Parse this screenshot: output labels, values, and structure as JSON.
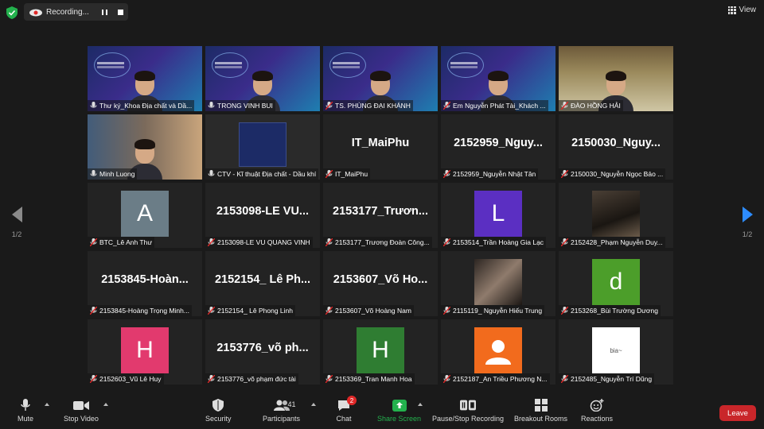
{
  "header": {
    "recording_label": "Recording...",
    "view_label": "View"
  },
  "pager": {
    "left_page": "1/2",
    "right_page": "1/2"
  },
  "colors": {
    "accent": "#2d8cff",
    "leave": "#c9262a",
    "active_border": "#d8e07a",
    "share": "#23b14d"
  },
  "tiles": [
    {
      "type": "video",
      "style": "banner",
      "name": "Thư ký_Khoa Địa chất và Dầ...",
      "muted": false,
      "active": true
    },
    {
      "type": "video",
      "style": "banner",
      "name": "TRONG VINH BUI",
      "muted": false
    },
    {
      "type": "video",
      "style": "banner",
      "name": "TS. PHÙNG ĐẠI KHÁNH",
      "muted": true
    },
    {
      "type": "video",
      "style": "banner",
      "name": "Em Nguyễn Phát Tài_Khách ...",
      "muted": true
    },
    {
      "type": "video",
      "style": "room",
      "name": "ĐÀO HỒNG HẢI",
      "muted": true
    },
    {
      "type": "video",
      "style": "room2",
      "name": "Minh Luong",
      "muted": false
    },
    {
      "type": "video",
      "style": "slide",
      "name": "CTV - Kĩ thuật Địa chất - Dầu khí",
      "muted": false
    },
    {
      "type": "text",
      "display": "IT_MaiPhu",
      "name": "IT_MaiPhu",
      "muted": true
    },
    {
      "type": "text",
      "display": "2152959_Nguy...",
      "name": "2152959_Nguyễn Nhật Tân",
      "muted": true
    },
    {
      "type": "text",
      "display": "2150030_Nguy...",
      "name": "2150030_Nguyễn Ngọc Bảo ...",
      "muted": true
    },
    {
      "type": "avatar",
      "letter": "A",
      "color": "#6b7d87",
      "name": "BTC_Lê Anh Thư",
      "muted": true
    },
    {
      "type": "text",
      "display": "2153098-LE VU...",
      "name": "2153098-LE VU QUANG VINH",
      "muted": true
    },
    {
      "type": "text",
      "display": "2153177_Trươn...",
      "name": "2153177_Trương Đoàn Công...",
      "muted": true
    },
    {
      "type": "avatar",
      "letter": "L",
      "color": "#5b2fc2",
      "name": "2153514_Trần Hoàng Gia Lạc",
      "muted": true
    },
    {
      "type": "photo",
      "style": "dark",
      "name": "2152428_Phạm Nguyễn Duy...",
      "muted": true
    },
    {
      "type": "text",
      "display": "2153845-Hoàn...",
      "name": "2153845-Hoàng Trọng Minh...",
      "muted": true
    },
    {
      "type": "text",
      "display": "2152154_ Lê Ph...",
      "name": "2152154_ Lê Phong Linh",
      "muted": true
    },
    {
      "type": "text",
      "display": "2153607_Võ Ho...",
      "name": "2153607_Võ Hoàng Nam",
      "muted": true
    },
    {
      "type": "photo",
      "style": "face",
      "name": "2115119_ Nguyễn Hiếu Trung",
      "muted": true
    },
    {
      "type": "avatar",
      "letter": "d",
      "color": "#4c9e2a",
      "name": "2153268_Bùi Trường Dương",
      "muted": true
    },
    {
      "type": "avatar",
      "letter": "H",
      "color": "#e23a6e",
      "name": "2152603_Vũ Lê Huy",
      "muted": true
    },
    {
      "type": "text",
      "display": "2153776_võ ph...",
      "name": "2153776_võ phạm đức tài",
      "muted": true
    },
    {
      "type": "avatar",
      "letter": "H",
      "color": "#2f7d32",
      "name": "2153369_Tran Manh Hoa",
      "muted": true
    },
    {
      "type": "avatar",
      "letter": "",
      "color": "#f26b1d",
      "name": "2152187_An Triều Phương N...",
      "muted": true,
      "silhouette": true
    },
    {
      "type": "photo",
      "style": "sticker",
      "caption": "bia~",
      "name": "2152485_Nguyễn Trí Dũng",
      "muted": true
    }
  ],
  "toolbar": {
    "mute": "Mute",
    "stop_video": "Stop Video",
    "security": "Security",
    "participants": "Participants",
    "participants_count": "41",
    "chat": "Chat",
    "chat_badge": "2",
    "share_screen": "Share Screen",
    "pause_recording": "Pause/Stop Recording",
    "breakout": "Breakout Rooms",
    "reactions": "Reactions",
    "leave": "Leave"
  }
}
